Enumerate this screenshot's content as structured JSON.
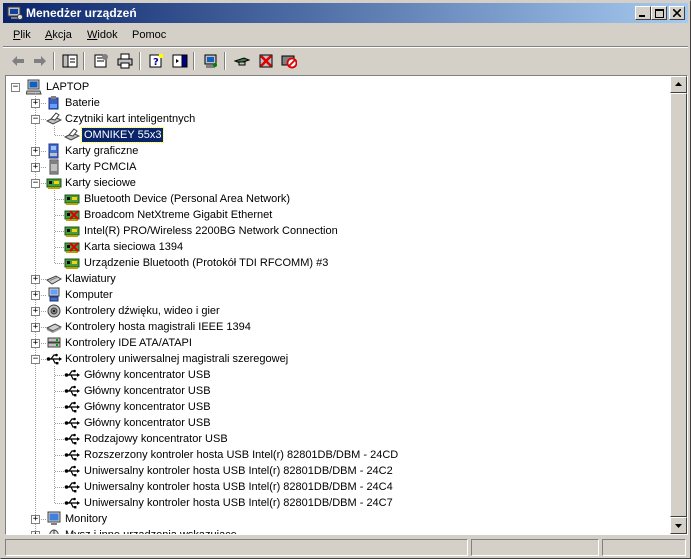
{
  "window": {
    "title": "Menedżer urządzeń",
    "icon": "device-manager-icon"
  },
  "menu": [
    {
      "label": "Plik",
      "accel": "P",
      "rest": "lik"
    },
    {
      "label": "Akcja",
      "accel": "A",
      "rest": "kcja"
    },
    {
      "label": "Widok",
      "accel": "W",
      "rest": "idok"
    },
    {
      "label": "Pomoc",
      "accel": "",
      "rest": "Pomoc"
    }
  ],
  "toolbar": {
    "buttons": [
      "back-arrow-icon",
      "forward-arrow-icon",
      "show-hide-tree-icon",
      "properties-icon",
      "print-icon",
      "help-icon",
      "console-tree-icon",
      "scan-hardware-icon",
      "update-driver-icon",
      "uninstall-icon",
      "disable-icon"
    ]
  },
  "tree": {
    "root": "LAPTOP",
    "items": [
      {
        "label": "Baterie",
        "level": 1,
        "expanded": false,
        "icon": "battery-icon"
      },
      {
        "label": "Czytniki kart inteligentnych",
        "level": 1,
        "expanded": true,
        "icon": "smartcard-reader-icon"
      },
      {
        "label": "OMNIKEY 55x3",
        "level": 2,
        "selected": true,
        "icon": "smartcard-reader-icon"
      },
      {
        "label": "Karty graficzne",
        "level": 1,
        "expanded": false,
        "icon": "display-adapter-icon"
      },
      {
        "label": "Karty PCMCIA",
        "level": 1,
        "expanded": false,
        "icon": "pcmcia-icon"
      },
      {
        "label": "Karty sieciowe",
        "level": 1,
        "expanded": true,
        "icon": "network-card-icon"
      },
      {
        "label": "Bluetooth Device (Personal Area Network)",
        "level": 2,
        "icon": "network-card-icon"
      },
      {
        "label": "Broadcom NetXtreme Gigabit Ethernet",
        "level": 2,
        "icon": "network-card-disabled-icon"
      },
      {
        "label": "Intel(R) PRO/Wireless 2200BG Network Connection",
        "level": 2,
        "icon": "network-card-icon"
      },
      {
        "label": "Karta sieciowa 1394",
        "level": 2,
        "icon": "network-card-disabled-icon"
      },
      {
        "label": "Urządzenie Bluetooth (Protokół TDI RFCOMM) #3",
        "level": 2,
        "icon": "network-card-icon"
      },
      {
        "label": "Klawiatury",
        "level": 1,
        "expanded": false,
        "icon": "keyboard-icon"
      },
      {
        "label": "Komputer",
        "level": 1,
        "expanded": false,
        "icon": "computer-icon"
      },
      {
        "label": "Kontrolery dźwięku, wideo i gier",
        "level": 1,
        "expanded": false,
        "icon": "sound-icon"
      },
      {
        "label": "Kontrolery hosta magistrali IEEE 1394",
        "level": 1,
        "expanded": false,
        "icon": "ieee1394-icon"
      },
      {
        "label": "Kontrolery IDE ATA/ATAPI",
        "level": 1,
        "expanded": false,
        "icon": "ide-controller-icon"
      },
      {
        "label": "Kontrolery uniwersalnej magistrali szeregowej",
        "level": 1,
        "expanded": true,
        "icon": "usb-icon"
      },
      {
        "label": "Główny koncentrator USB",
        "level": 2,
        "icon": "usb-icon"
      },
      {
        "label": "Główny koncentrator USB",
        "level": 2,
        "icon": "usb-icon"
      },
      {
        "label": "Główny koncentrator USB",
        "level": 2,
        "icon": "usb-icon"
      },
      {
        "label": "Główny koncentrator USB",
        "level": 2,
        "icon": "usb-icon"
      },
      {
        "label": "Rodzajowy koncentrator USB",
        "level": 2,
        "icon": "usb-icon"
      },
      {
        "label": "Rozszerzony kontroler hosta USB Intel(r) 82801DB/DBM - 24CD",
        "level": 2,
        "icon": "usb-icon"
      },
      {
        "label": "Uniwersalny kontroler hosta USB Intel(r) 82801DB/DBM - 24C2",
        "level": 2,
        "icon": "usb-icon"
      },
      {
        "label": "Uniwersalny kontroler hosta USB Intel(r) 82801DB/DBM - 24C4",
        "level": 2,
        "icon": "usb-icon"
      },
      {
        "label": "Uniwersalny kontroler hosta USB Intel(r) 82801DB/DBM - 24C7",
        "level": 2,
        "icon": "usb-icon"
      },
      {
        "label": "Monitory",
        "level": 1,
        "expanded": false,
        "icon": "monitor-icon"
      },
      {
        "label": "Mysz i inne urządzenia wskazujące",
        "level": 1,
        "expanded": false,
        "icon": "mouse-icon"
      }
    ]
  },
  "colors": {
    "titlebar_start": "#0a246a",
    "titlebar_end": "#a6caf0",
    "selection": "#0a246a",
    "chrome": "#d4d0c8"
  }
}
